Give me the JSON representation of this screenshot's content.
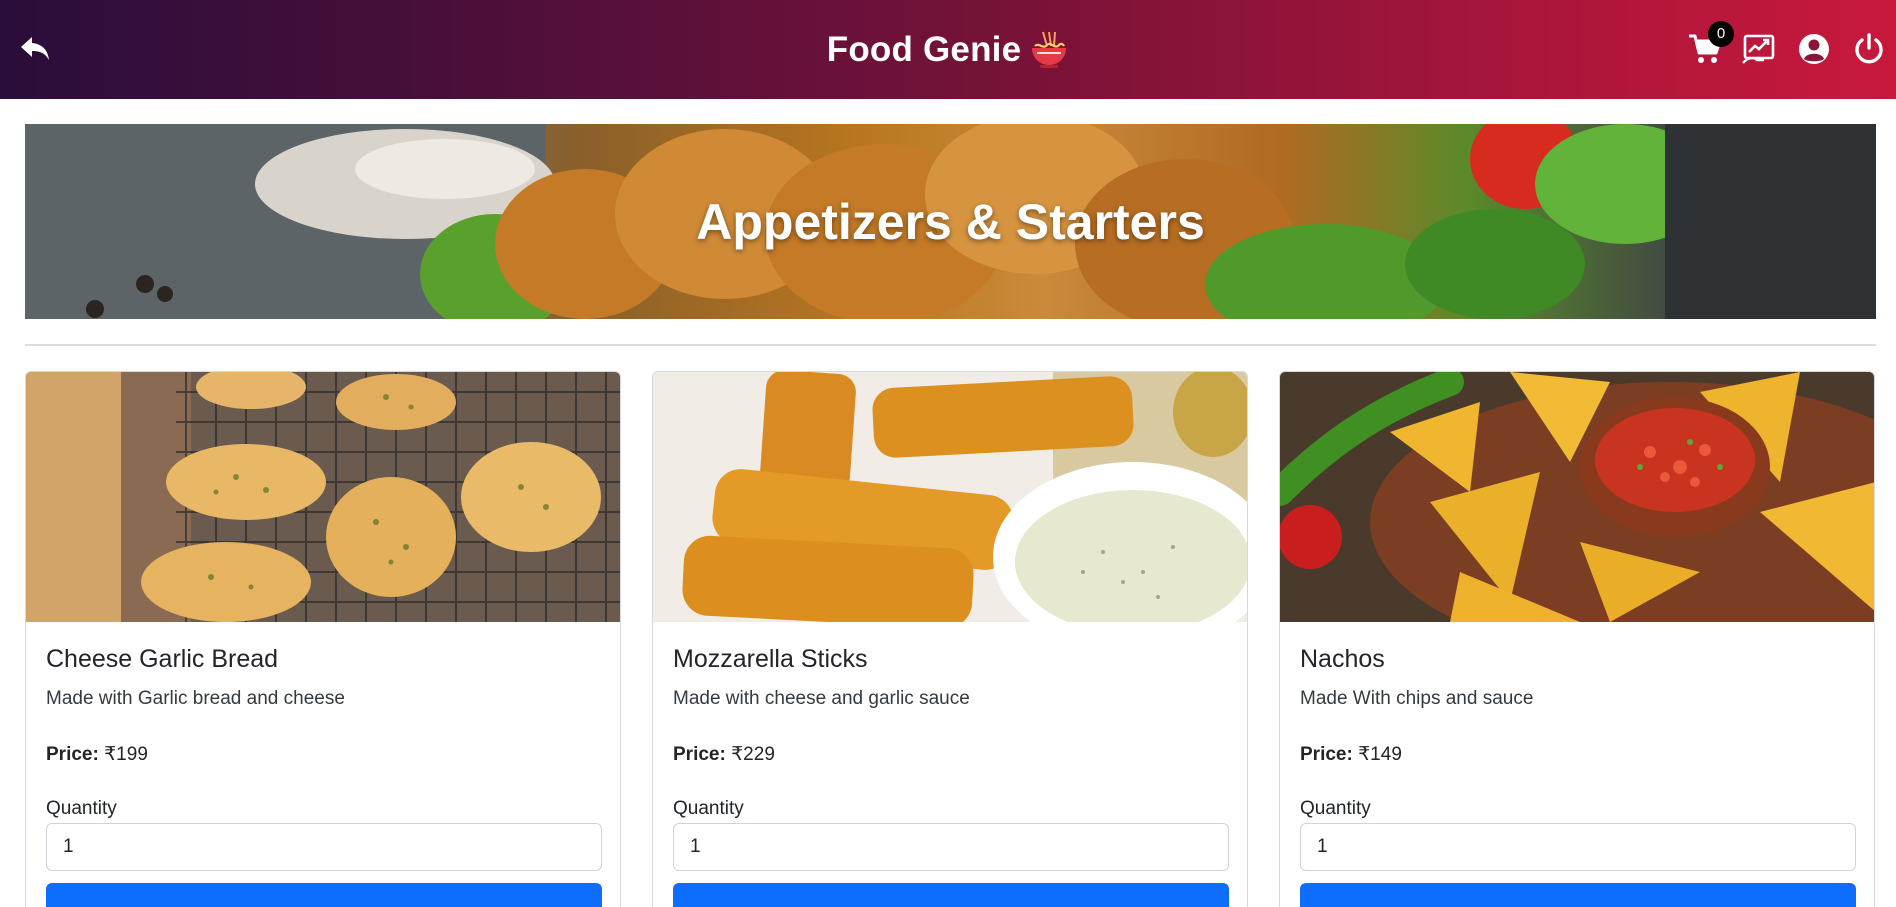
{
  "app": {
    "title": "Food Genie",
    "brand_icon": "noodle-bowl-icon"
  },
  "navbar": {
    "back_icon": "reply-arrow-icon",
    "cart_icon": "shopping-cart-icon",
    "cart_count": "0",
    "orders_icon": "order-history-icon",
    "profile_icon": "user-circle-icon",
    "logout_icon": "power-icon",
    "gradient_start": "#2a0d3a",
    "gradient_end": "#c8183c"
  },
  "hero": {
    "title": "Appetizers & Starters"
  },
  "labels": {
    "price": "Price:",
    "quantity": "Quantity"
  },
  "products": [
    {
      "name": "Cheese Garlic Bread",
      "description": "Made with Garlic bread and cheese",
      "price": "₹199",
      "quantity": "1"
    },
    {
      "name": "Mozzarella Sticks",
      "description": "Made with cheese and garlic sauce",
      "price": "₹229",
      "quantity": "1"
    },
    {
      "name": "Nachos",
      "description": "Made With chips and sauce",
      "price": "₹149",
      "quantity": "1"
    }
  ],
  "colors": {
    "primary_button": "#0d6efd",
    "badge_bg": "#000000"
  }
}
